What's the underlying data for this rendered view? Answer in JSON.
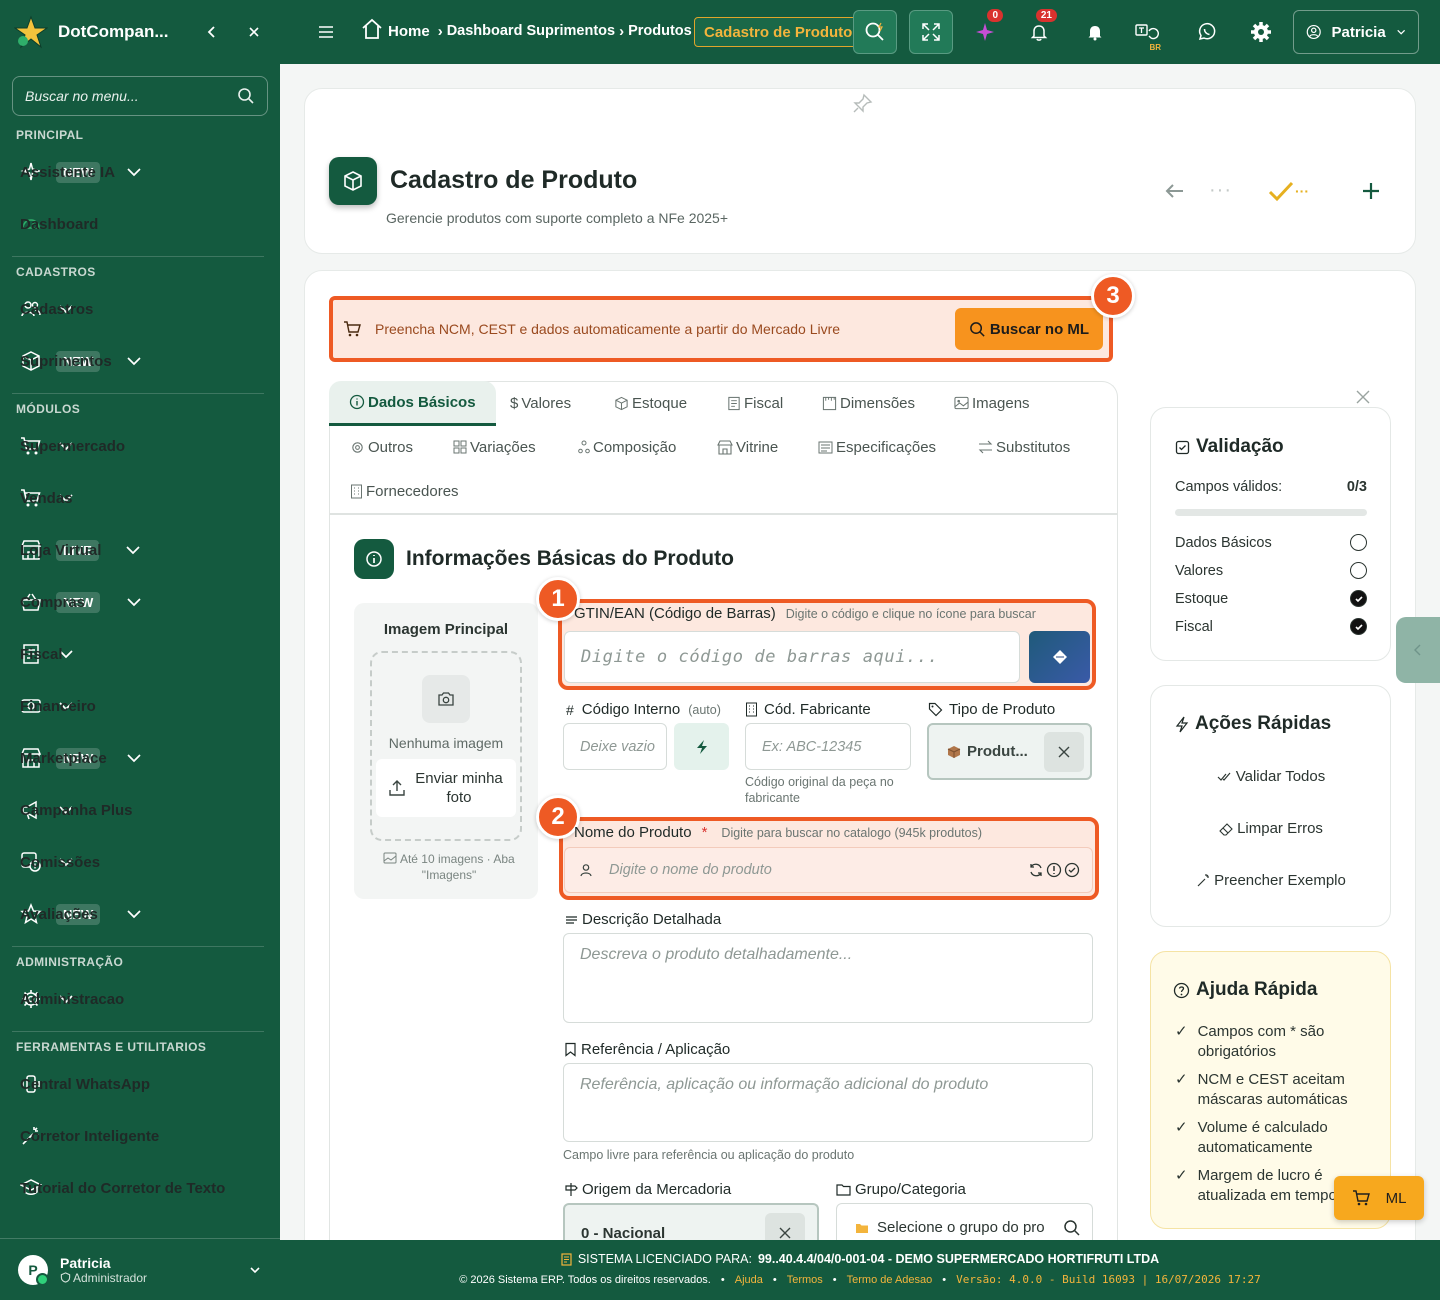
{
  "colors": {
    "brand": "#145a3f",
    "accent": "#ee5a24",
    "gold": "#f3b43c",
    "ml_orange": "#f7931e"
  },
  "sidebar": {
    "brand": "DotCompan...",
    "search_placeholder": "Buscar no menu...",
    "sections": {
      "principal": "PRINCIPAL",
      "cadastros": "CADASTROS",
      "modulos": "MÓDULOS",
      "admin": "ADMINISTRAÇÃO",
      "tools": "FERRAMENTAS E UTILITARIOS"
    },
    "items": [
      {
        "label": "Assistente IA",
        "badge": "NEW",
        "icon": "sparkle-icon"
      },
      {
        "label": "Dashboard",
        "badge": "",
        "icon": "gauge-icon"
      },
      {
        "label": "Cadastros",
        "badge": "",
        "icon": "users-icon"
      },
      {
        "label": "Suprimentos",
        "badge": "NEW",
        "icon": "box-icon"
      },
      {
        "label": "Supermercado",
        "badge": "",
        "icon": "cart-icon"
      },
      {
        "label": "Vendas",
        "badge": "",
        "icon": "cart-icon"
      },
      {
        "label": "Loja Virtual",
        "badge": "LIVE",
        "icon": "store-icon"
      },
      {
        "label": "Compras",
        "badge": "NEW",
        "icon": "basket-icon"
      },
      {
        "label": "Fiscal",
        "badge": "",
        "icon": "receipt-icon"
      },
      {
        "label": "Financeiro",
        "badge": "",
        "icon": "money-icon"
      },
      {
        "label": "Marketplace",
        "badge": "NEW",
        "icon": "store-icon"
      },
      {
        "label": "Campanha Plus",
        "badge": "",
        "icon": "megaphone-icon"
      },
      {
        "label": "Comissões",
        "badge": "",
        "icon": "commission-icon"
      },
      {
        "label": "Avaliações",
        "badge": "NEW",
        "icon": "star-icon"
      },
      {
        "label": "Administracao",
        "badge": "",
        "icon": "gear-icon"
      },
      {
        "label": "Central WhatsApp",
        "badge": "",
        "icon": "phone-icon"
      },
      {
        "label": "Corretor Inteligente",
        "badge": "",
        "icon": "wand-icon"
      },
      {
        "label": "Tutorial do Corretor de Texto",
        "badge": "",
        "icon": "graduation-icon"
      }
    ],
    "user": {
      "initial": "P",
      "name": "Patricia",
      "role": "Administrador"
    }
  },
  "topbar": {
    "breadcrumb": [
      "Home",
      "Dashboard Suprimentos",
      "Produtos"
    ],
    "active_crumb": "Cadastro de Produto",
    "ai_count": "0",
    "notif_count": "21",
    "lang": "BR",
    "user": "Patricia"
  },
  "header": {
    "title": "Cadastro de Produto",
    "subtitle": "Gerencie produtos com suporte completo a NFe 2025+",
    "more_dots": "···"
  },
  "ml_banner": {
    "text": "Preencha NCM, CEST e dados automaticamente a partir do Mercado Livre",
    "button": "Buscar no ML",
    "step": "3"
  },
  "tabs": [
    "Dados Básicos",
    "Valores",
    "Estoque",
    "Fiscal",
    "Dimensões",
    "Imagens",
    "Outros",
    "Variações",
    "Composição",
    "Vitrine",
    "Especificações",
    "Substitutos",
    "Fornecedores"
  ],
  "section": {
    "title": "Informações Básicas do Produto"
  },
  "image_panel": {
    "title": "Imagem Principal",
    "empty": "Nenhuma imagem",
    "upload": "Enviar minha foto",
    "hint": "Até 10 imagens · Aba \"Imagens\""
  },
  "form": {
    "gtin": {
      "step": "1",
      "label": "GTIN/EAN (Código de Barras)",
      "hint": "Digite o código e clique no ícone para buscar",
      "placeholder": "Digite o código de barras aqui..."
    },
    "codigo_interno": {
      "label": "Código Interno",
      "tag": "(auto)",
      "placeholder": "Deixe vazio"
    },
    "cod_fabricante": {
      "label": "Cód. Fabricante",
      "placeholder": "Ex: ABC-12345",
      "note": "Código original da peça no fabricante"
    },
    "tipo_produto": {
      "label": "Tipo de Produto",
      "value": "Produt..."
    },
    "nome": {
      "step": "2",
      "label": "Nome do Produto",
      "required": "*",
      "hint": "Digite para buscar no catalogo (945k produtos)",
      "placeholder": "Digite o nome do produto"
    },
    "descricao": {
      "label": "Descrição Detalhada",
      "placeholder": "Descreva o produto detalhadamente..."
    },
    "referencia": {
      "label": "Referência / Aplicação",
      "placeholder": "Referência, aplicação ou informação adicional do produto",
      "note": "Campo livre para referência ou aplicação do produto"
    },
    "origem": {
      "label": "Origem da Mercadoria",
      "value": "0 - Nacional"
    },
    "grupo": {
      "label": "Grupo/Categoria",
      "placeholder": "Selecione o grupo do produto"
    }
  },
  "validacao": {
    "title": "Validação",
    "campos_label": "Campos válidos:",
    "campos_value": "0/3",
    "progress": 0,
    "items": [
      {
        "label": "Dados Básicos",
        "done": false
      },
      {
        "label": "Valores",
        "done": false
      },
      {
        "label": "Estoque",
        "done": true
      },
      {
        "label": "Fiscal",
        "done": true
      }
    ]
  },
  "acoes": {
    "title": "Ações Rápidas",
    "items": [
      "Validar Todos",
      "Limpar Erros",
      "Preencher Exemplo"
    ]
  },
  "ajuda": {
    "title": "Ajuda Rápida",
    "items": [
      "Campos com * são obrigatórios",
      "NCM e CEST aceitam máscaras automáticas",
      "Volume é calculado automaticamente",
      "Margem de lucro é atualizada em tempo real"
    ]
  },
  "ml_float": "ML",
  "footer": {
    "license_label": "SISTEMA LICENCIADO PARA:",
    "license_value": "99..40.4.4/04/0-001-04 - DEMO SUPERMERCADO HORTIFRUTI LTDA",
    "copyright": "© 2026 Sistema ERP. Todos os direitos reservados.",
    "links": [
      "Ajuda",
      "Termos",
      "Termo de Adesao"
    ],
    "version": "Versão: 4.0.0 - Build 16093 | 16/07/2026 17:27"
  }
}
